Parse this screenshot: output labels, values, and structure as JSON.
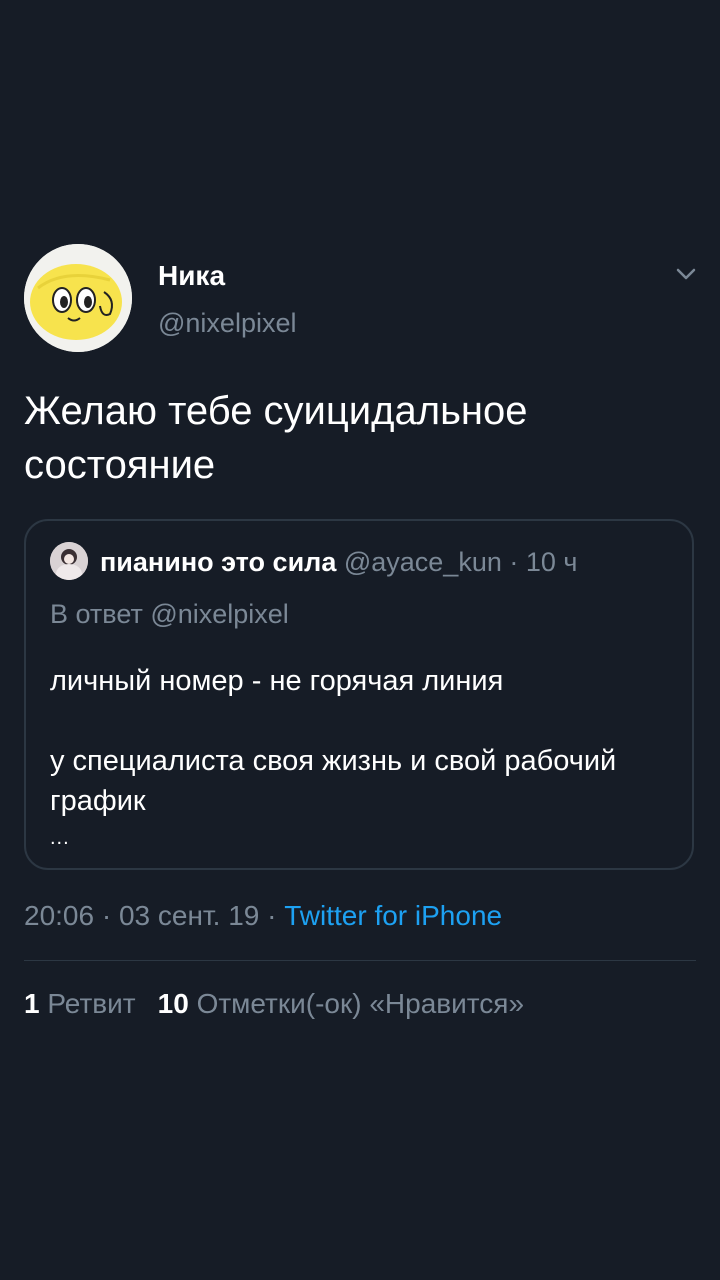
{
  "tweet": {
    "author_name": "Ника",
    "author_handle": "@nixelpixel",
    "text": "Желаю тебе суицидальное состояние",
    "timestamp": "20:06 · 03 сент. 19 · ",
    "source": "Twitter for iPhone"
  },
  "quoted": {
    "name": "пианино это сила",
    "meta": " @ayace_kun · 10 ч",
    "reply_to": "В ответ @nixelpixel",
    "line1": "личный номер - не горячая линия",
    "line2": "у специалиста своя жизнь и свой рабочий график",
    "ellipsis": "..."
  },
  "stats": {
    "retweets_count": "1",
    "retweets_label": "Ретвит",
    "likes_count": "10",
    "likes_label": "Отметки(-ок) «Нравится»"
  },
  "icons": {
    "menu": "chevron-down-icon"
  },
  "colors": {
    "background": "#161c26",
    "secondary_text": "#7b8896",
    "link": "#1da1f2",
    "border": "#2c3743"
  }
}
